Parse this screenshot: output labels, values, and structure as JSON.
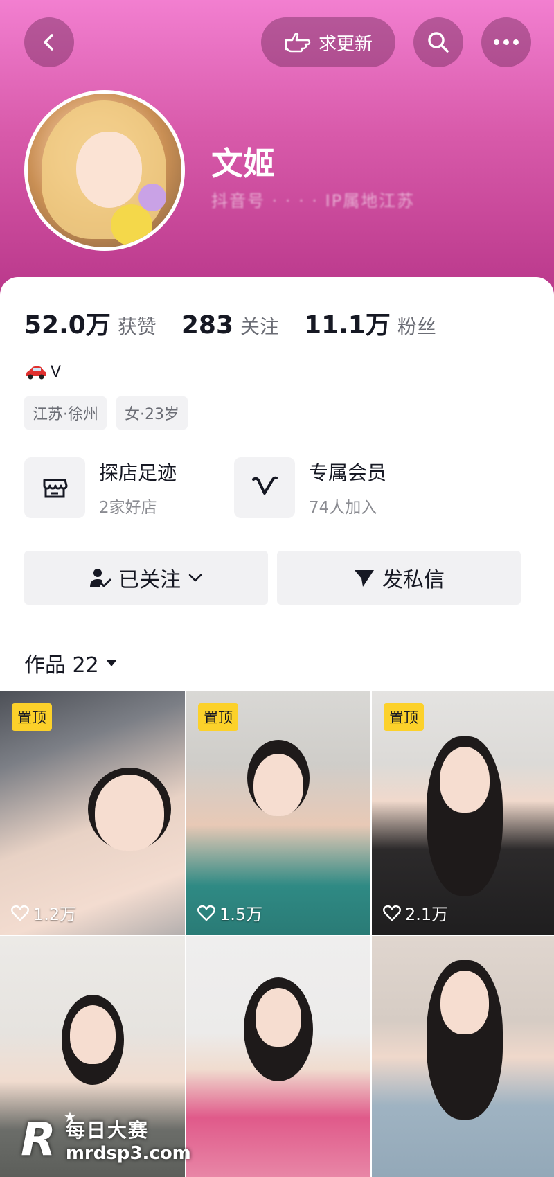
{
  "header": {
    "update_label": "求更新",
    "name": "文姬",
    "sub_id": "抖音号 · · · · IP属地江苏"
  },
  "stats": [
    {
      "value": "52.0万",
      "label": "获赞"
    },
    {
      "value": "283",
      "label": "关注"
    },
    {
      "value": "11.1万",
      "label": "粉丝"
    }
  ],
  "bio": {
    "text": "V"
  },
  "tags": [
    "江苏·徐州",
    "女·23岁"
  ],
  "features": [
    {
      "title": "探店足迹",
      "sub": "2家好店"
    },
    {
      "title": "专属会员",
      "sub": "74人加入"
    }
  ],
  "actions": {
    "follow_label": "已关注",
    "message_label": "发私信"
  },
  "works": {
    "title": "作品 22"
  },
  "videos": [
    {
      "pinned": "置顶",
      "likes": "1.2万"
    },
    {
      "pinned": "置顶",
      "likes": "1.5万"
    },
    {
      "pinned": "置顶",
      "likes": "2.1万"
    },
    {
      "pinned": "",
      "likes": ""
    },
    {
      "pinned": "",
      "likes": ""
    },
    {
      "pinned": "",
      "likes": ""
    }
  ],
  "watermark": {
    "logo": "R",
    "cn": "每日大赛",
    "url": "mrdsp3.com"
  },
  "colors": {
    "header_top": "#f27fd0",
    "header_bottom": "#b9378a",
    "pin_badge": "#fcd12a"
  }
}
